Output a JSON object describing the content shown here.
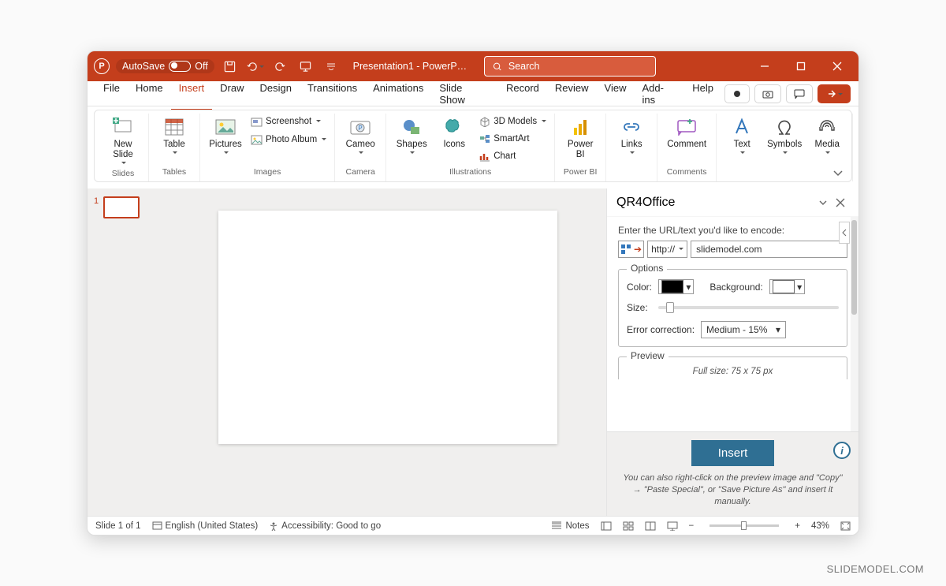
{
  "titlebar": {
    "autosave_label": "AutoSave",
    "autosave_state": "Off",
    "title": "Presentation1  -  PowerP…",
    "search_placeholder": "Search"
  },
  "tabs": {
    "items": [
      "File",
      "Home",
      "Insert",
      "Draw",
      "Design",
      "Transitions",
      "Animations",
      "Slide Show",
      "Record",
      "Review",
      "View",
      "Add-ins",
      "Help"
    ],
    "active_index": 2
  },
  "ribbon": {
    "slides_label": "Slides",
    "new_slide": "New\nSlide",
    "tables_label": "Tables",
    "table": "Table",
    "images_label": "Images",
    "pictures": "Pictures",
    "screenshot": "Screenshot",
    "photo_album": "Photo Album",
    "camera_label": "Camera",
    "cameo": "Cameo",
    "illus_label": "Illustrations",
    "shapes": "Shapes",
    "icons": "Icons",
    "models3d": "3D Models",
    "smartart": "SmartArt",
    "chart": "Chart",
    "powerbi_label": "Power BI",
    "powerbi": "Power\nBI",
    "links": "Links",
    "comments_label": "Comments",
    "comment": "Comment",
    "text": "Text",
    "symbols": "Symbols",
    "media": "Media"
  },
  "thumbnails": {
    "slide1_num": "1"
  },
  "panel": {
    "title": "QR4Office",
    "url_label": "Enter the URL/text you'd like to encode:",
    "protocol": "http://",
    "url_value": "slidemodel.com",
    "options_legend": "Options",
    "color_label": "Color:",
    "bg_label": "Background:",
    "size_label": "Size:",
    "err_label": "Error correction:",
    "err_value": "Medium - 15%",
    "preview_legend": "Preview",
    "preview_size": "Full size: 75 x 75 px",
    "insert": "Insert",
    "hint": "You can also right-click on the preview image and \"Copy\" → \"Paste Special\", or \"Save Picture As\" and insert it manually."
  },
  "status": {
    "slide": "Slide 1 of 1",
    "lang": "English (United States)",
    "access": "Accessibility: Good to go",
    "notes": "Notes",
    "zoom": "43%"
  },
  "watermark": "SLIDEMODEL.COM"
}
